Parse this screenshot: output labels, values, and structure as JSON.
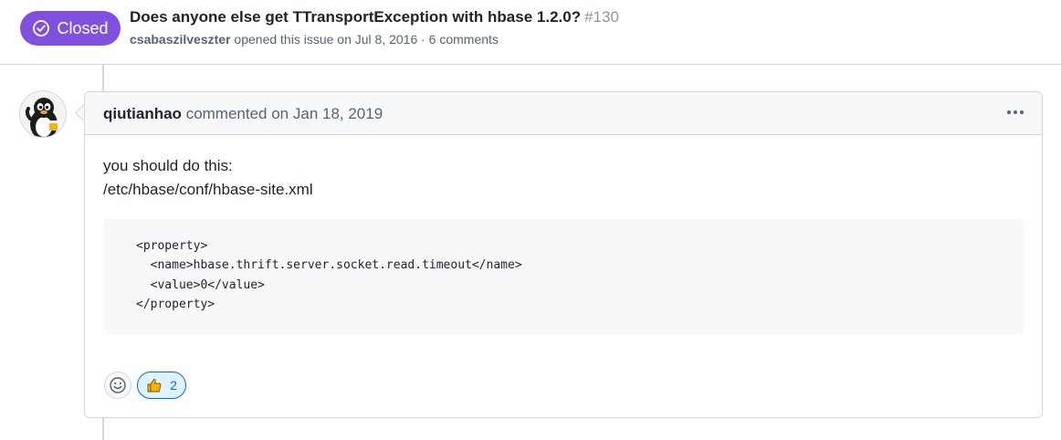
{
  "issue": {
    "state_label": "Closed",
    "title": "Does anyone else get TTransportException with hbase 1.2.0?",
    "number": "#130",
    "author": "csabaszilveszter",
    "meta_text": "opened this issue on Jul 8, 2016 · 6 comments",
    "state_color": "#8250df",
    "state_icon": "check-circle-icon"
  },
  "comment": {
    "author": "qiutianhao",
    "action_text": "commented on Jan 18, 2019",
    "body_lines": [
      "you should do this:",
      "/etc/hbase/conf/hbase-site.xml"
    ],
    "code_lines": [
      "<property>",
      "  <name>hbase.thrift.server.socket.read.timeout</name>",
      "  <value>0</value>",
      "</property>"
    ],
    "menu_icon": "kebab-horizontal-icon"
  },
  "reactions": {
    "add_icon": "smiley-icon",
    "items": [
      {
        "emoji": "thumbs-up-icon",
        "count": "2"
      }
    ],
    "accent_color": "#0969da"
  }
}
